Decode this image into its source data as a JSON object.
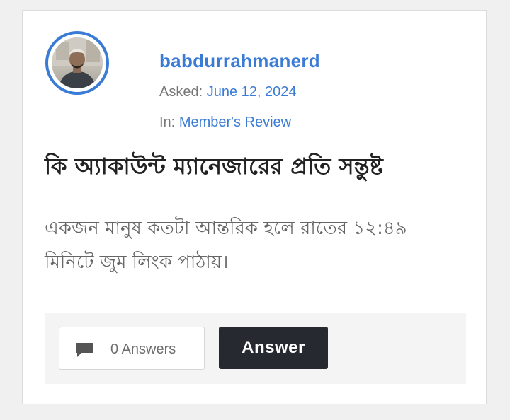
{
  "question": {
    "author": {
      "username": "babdurrahmanerd"
    },
    "asked": {
      "label": "Asked:",
      "date": "June 12, 2024"
    },
    "category": {
      "label": "In:",
      "name": "Member's Review"
    },
    "title": "কি অ্যাকাউন্ট ম্যানেজারের প্রতি সন্তুষ্ট",
    "excerpt_lines": [
      "একজন মানুষ কতটা আন্তরিক হলে রাতের ১২:৪৯",
      "মিনিটে জুম লিংক পাঠায়।"
    ]
  },
  "footer": {
    "answers_count_label": "0 Answers",
    "answer_button_label": "Answer"
  },
  "icons": {
    "answers": "comment-icon"
  },
  "colors": {
    "accent": "#3a7bd5",
    "answer_button_bg": "#262a30",
    "title_text": "#222222"
  }
}
